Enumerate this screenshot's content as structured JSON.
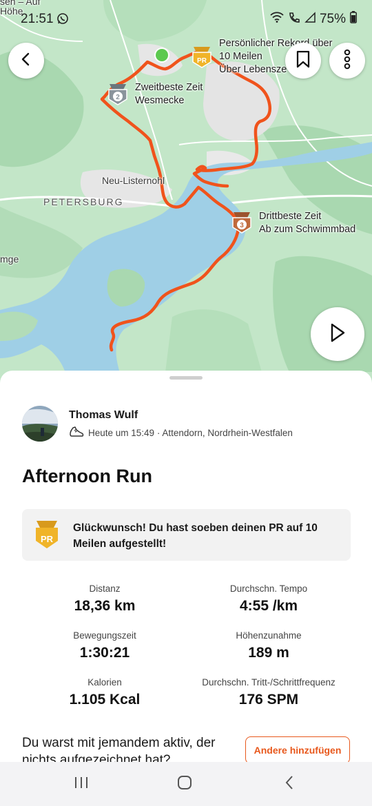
{
  "status_bar": {
    "time": "21:51",
    "battery": "75%"
  },
  "map": {
    "place_labels": {
      "top_left_1": "sen – Auf",
      "top_left_2": "Höhe",
      "neu_listernohl": "Neu-Listernohl",
      "petersburg": "PETERSBURG",
      "left_edge": "mge"
    },
    "segments": {
      "pr": {
        "line1": "Persönlicher Rekord über",
        "line2": "10 Meilen",
        "line3": "Über Lebensze",
        "badge": "PR"
      },
      "second": {
        "line1": "Zweitbeste Zeit",
        "line2": "Wesmecke",
        "badge": "2"
      },
      "third": {
        "line1": "Drittbeste Zeit",
        "line2": "Ab zum Schwimmbad",
        "badge": "3"
      }
    },
    "colors": {
      "route": "#f0531c",
      "start": "#5cc94f",
      "pr_gold": "#f0b429",
      "silver": "#8a949c",
      "bronze": "#c06a3c",
      "water": "#9ecfe8",
      "land": "#bfe3c5"
    }
  },
  "toolbar": {
    "back_icon": "chevron-left-icon",
    "bookmark_icon": "bookmark-icon",
    "more_icon": "more-vertical-icon",
    "play_icon": "play-icon"
  },
  "athlete": {
    "name": "Thomas Wulf",
    "meta": "Heute um 15:49 · Attendorn, Nordrhein-Westfalen"
  },
  "activity": {
    "title": "Afternoon Run"
  },
  "pr_banner": {
    "badge": "PR",
    "text": "Glückwunsch! Du hast soeben deinen PR auf 10 Meilen aufgestellt!"
  },
  "stats": [
    {
      "label": "Distanz",
      "value": "18,36 km"
    },
    {
      "label": "Durchschn. Tempo",
      "value": "4:55 /km"
    },
    {
      "label": "Bewegungszeit",
      "value": "1:30:21"
    },
    {
      "label": "Höhenzunahme",
      "value": "189 m"
    },
    {
      "label": "Kalorien",
      "value": "1.105 Kcal"
    },
    {
      "label": "Durchschn. Tritt-/Schrittfrequenz",
      "value": "176 SPM"
    }
  ],
  "with_others": {
    "text": "Du warst mit jemandem aktiv, der nichts aufgezeichnet hat?",
    "button": "Andere hinzufügen"
  },
  "accent": "#e8581c"
}
